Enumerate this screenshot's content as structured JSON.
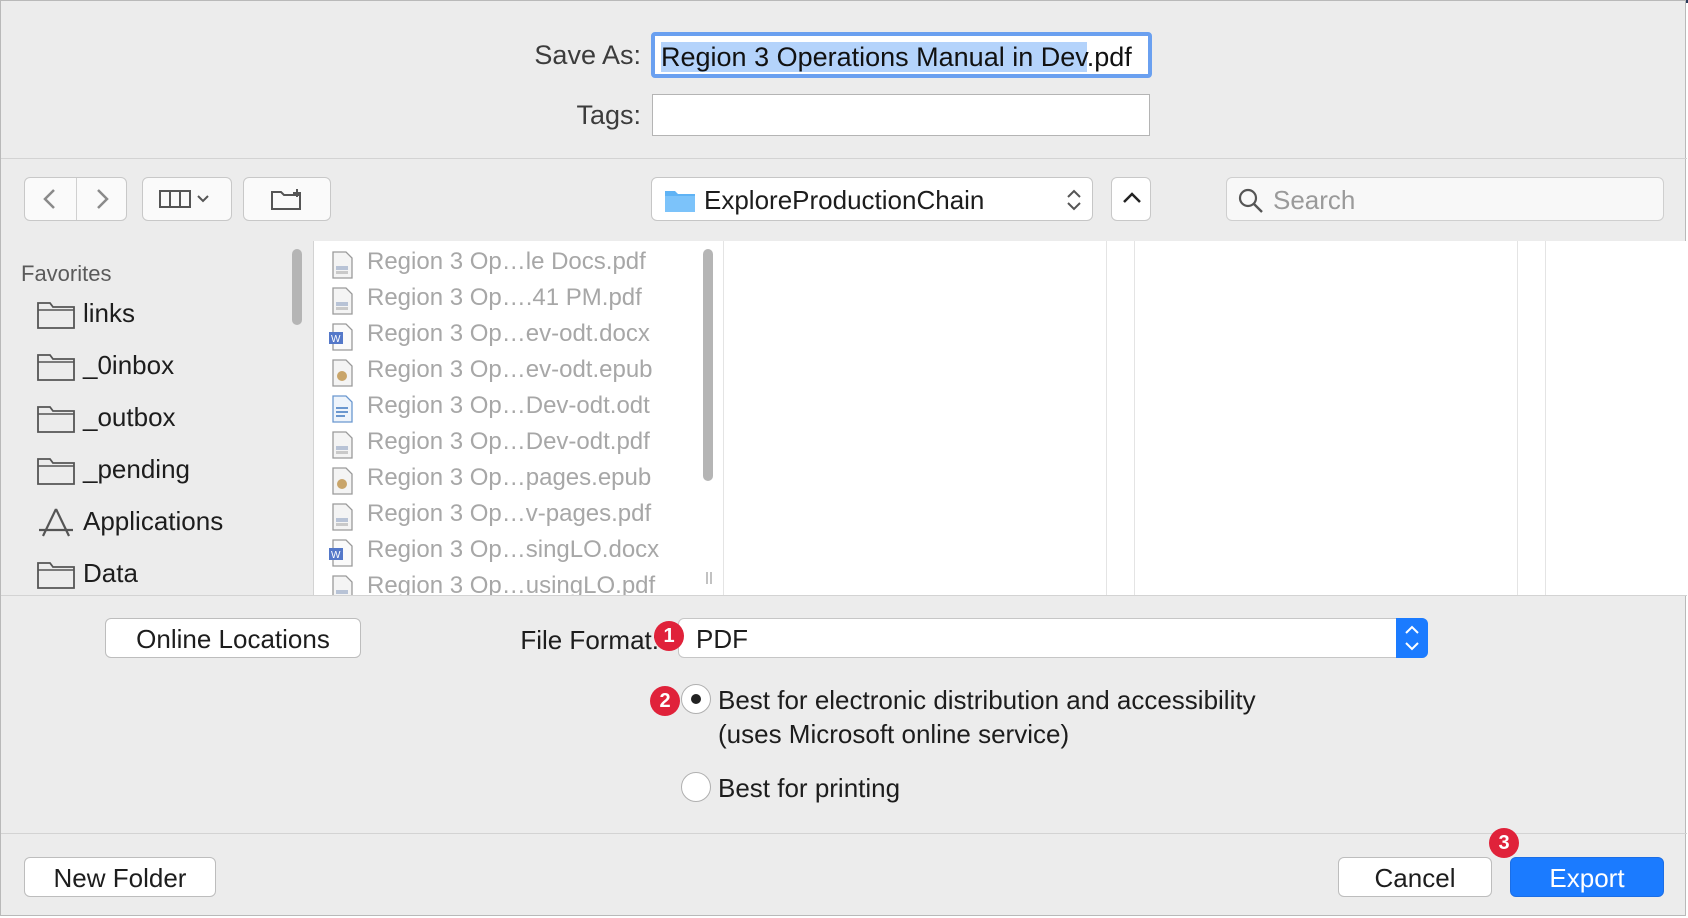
{
  "save_as": {
    "label": "Save As:",
    "filename_selected": "Region 3 Operations Manual in Dev",
    "filename_ext": ".pdf"
  },
  "tags": {
    "label": "Tags:",
    "value": ""
  },
  "toolbar": {
    "location": "ExploreProductionChain",
    "search_placeholder": "Search"
  },
  "sidebar": {
    "heading": "Favorites",
    "items": [
      {
        "label": "links",
        "icon": "folder-icon"
      },
      {
        "label": "_0inbox",
        "icon": "folder-icon"
      },
      {
        "label": "_outbox",
        "icon": "folder-icon"
      },
      {
        "label": "_pending",
        "icon": "folder-icon"
      },
      {
        "label": "Applications",
        "icon": "applications-icon"
      },
      {
        "label": "Data",
        "icon": "folder-icon"
      }
    ]
  },
  "files": [
    {
      "name": "Region 3 Op…le Docs.pdf",
      "icon": "pdf-icon"
    },
    {
      "name": "Region 3 Op….41 PM.pdf",
      "icon": "pdf-icon"
    },
    {
      "name": "Region 3 Op…ev-odt.docx",
      "icon": "word-icon"
    },
    {
      "name": "Region 3 Op…ev-odt.epub",
      "icon": "epub-icon"
    },
    {
      "name": "Region 3 Op…Dev-odt.odt",
      "icon": "odt-icon"
    },
    {
      "name": "Region 3 Op…Dev-odt.pdf",
      "icon": "pdf-icon"
    },
    {
      "name": "Region 3 Op…pages.epub",
      "icon": "epub-icon"
    },
    {
      "name": "Region 3 Op…v-pages.pdf",
      "icon": "pdf-icon"
    },
    {
      "name": "Region 3 Op…singLO.docx",
      "icon": "word-icon"
    },
    {
      "name": "Region 3 Op…usingLO.pdf",
      "icon": "pdf-icon"
    }
  ],
  "options": {
    "online_locations": "Online Locations",
    "file_format_label": "File Format:",
    "file_format_value": "PDF",
    "radio_electronic_line1": "Best for electronic distribution and accessibility",
    "radio_electronic_line2": "(uses Microsoft online service)",
    "radio_printing": "Best for printing",
    "selected_option": "electronic"
  },
  "badges": {
    "one": "1",
    "two": "2",
    "three": "3"
  },
  "footer": {
    "new_folder": "New Folder",
    "cancel": "Cancel",
    "export": "Export"
  },
  "colors": {
    "accent": "#1b7bff",
    "badge": "#e0223a",
    "selection": "#b4d3fb"
  }
}
